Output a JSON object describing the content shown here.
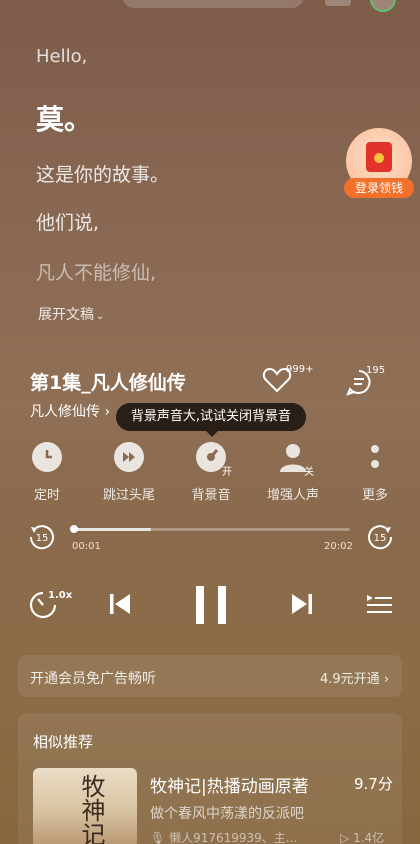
{
  "story": {
    "hello": "Hello,",
    "name": "莫。",
    "line1": "这是你的故事。",
    "line2": "他们说,",
    "line3": "凡人不能修仙,",
    "expand": "展开文稿"
  },
  "promo": {
    "label": "登录领钱"
  },
  "episode": {
    "title": "第1集_凡人修仙传",
    "album": "凡人修仙传",
    "likes": "999+",
    "comments": "195"
  },
  "tooltip": "背景声音大,试试关闭背景音",
  "controls": [
    {
      "label": "定时",
      "icon": "clock-icon"
    },
    {
      "label": "跳过头尾",
      "icon": "skip-forward-icon"
    },
    {
      "label": "背景音",
      "icon": "background-sound-icon",
      "tag": "开"
    },
    {
      "label": "增强人声",
      "icon": "voice-enhance-icon",
      "tag": "关"
    },
    {
      "label": "更多",
      "icon": "more-icon"
    }
  ],
  "player": {
    "current_time": "00:01",
    "total_time": "20:02",
    "progress": 0.28,
    "skip_back": "15",
    "skip_forward": "15",
    "speed": "1.0x"
  },
  "member": {
    "text": "开通会员免广告畅听",
    "cta": "4.9元开通"
  },
  "recommend": {
    "title": "相似推荐",
    "cover_text": "牧神记",
    "items": [
      {
        "name": "牧神记|热播动画原著",
        "score": "9.7分",
        "desc": "做个春风中荡漾的反派吧",
        "author": "懒人917619939、主...",
        "plays": "1.4亿"
      }
    ]
  }
}
